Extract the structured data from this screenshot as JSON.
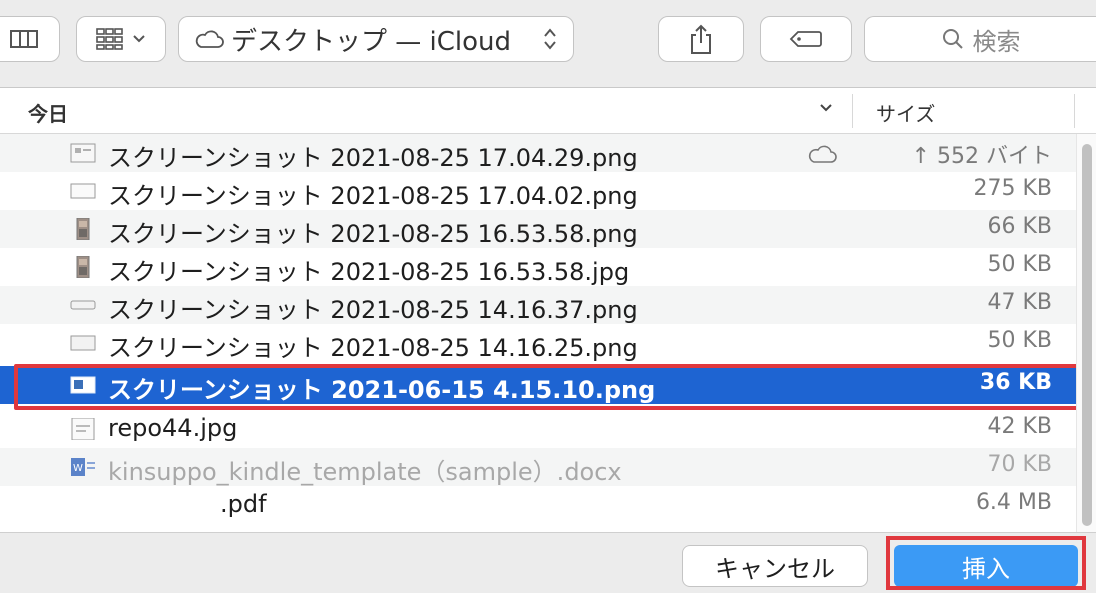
{
  "toolbar": {
    "location_label": "デスクトップ — iCloud",
    "search_placeholder": "検索"
  },
  "header": {
    "name_column": "今日",
    "size_column": "サイズ"
  },
  "files": [
    {
      "name": "スクリーンショット 2021-08-25 17.04.29.png",
      "size": "↑ 552 バイト"
    },
    {
      "name": "スクリーンショット 2021-08-25 17.04.02.png",
      "size": "275 KB"
    },
    {
      "name": "スクリーンショット 2021-08-25 16.53.58.png",
      "size": "66 KB"
    },
    {
      "name": "スクリーンショット 2021-08-25 16.53.58.jpg",
      "size": "50 KB"
    },
    {
      "name": "スクリーンショット 2021-08-25 14.16.37.png",
      "size": "47 KB"
    },
    {
      "name": "スクリーンショット 2021-08-25 14.16.25.png",
      "size": "50 KB"
    },
    {
      "name": "スクリーンショット 2021-06-15 4.15.10.png",
      "size": "36 KB"
    },
    {
      "name": "repo44.jpg",
      "size": "42 KB"
    },
    {
      "name": "kinsuppo_kindle_template（sample）.docx",
      "size": "70 KB"
    },
    {
      "name": ".pdf",
      "size": "6.4 MB"
    }
  ],
  "footer": {
    "cancel_label": "キャンセル",
    "insert_label": "挿入"
  },
  "colors": {
    "selection": "#1e64d2",
    "primary_button": "#3b9af5",
    "highlight_outline": "#e0383e"
  }
}
